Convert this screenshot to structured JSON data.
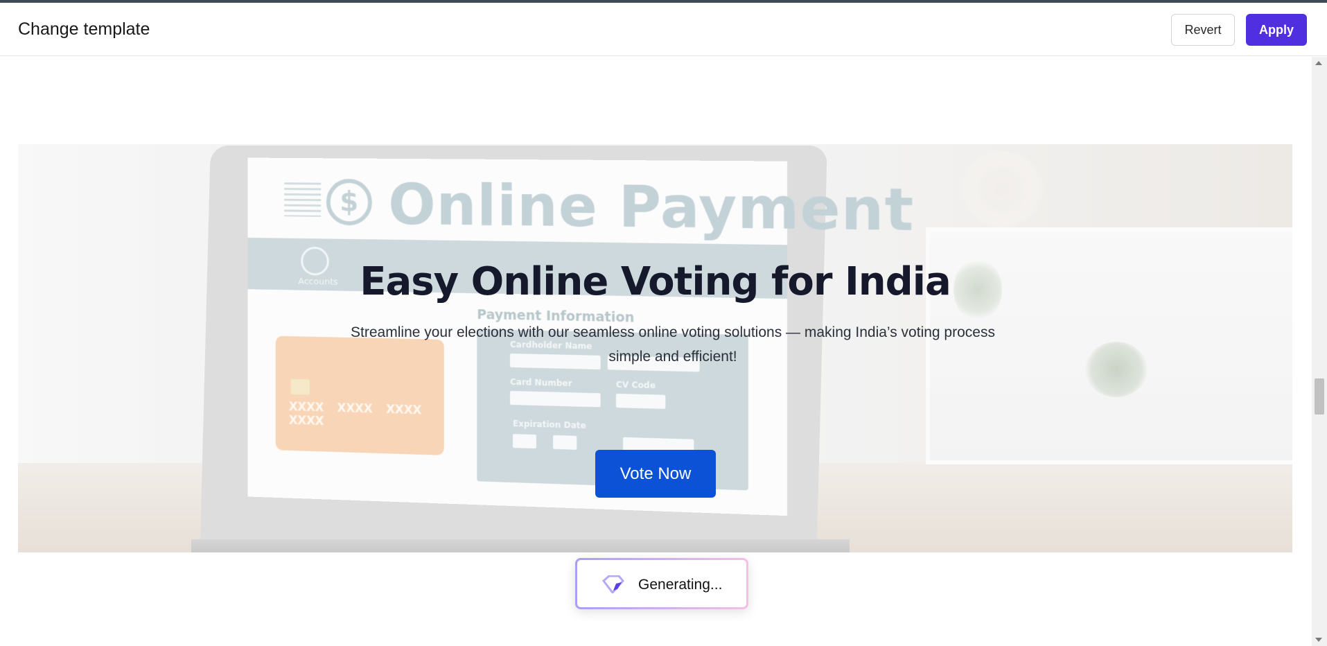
{
  "header": {
    "title": "Change template",
    "revert_label": "Revert",
    "apply_label": "Apply"
  },
  "hero": {
    "title": "Easy Online Voting for India",
    "subtitle": "Streamline your elections with our seamless online voting solutions — making India’s voting process simple and efficient!",
    "cta_label": "Vote Now",
    "background_image": {
      "title": "Online Payment",
      "band_item": "Accounts",
      "section_heading": "Payment Information",
      "card_number": "XXXX XXXX XXXX XXXX",
      "form_labels": [
        "Cardholder Name",
        "Card Number",
        "CV Code",
        "Expiration Date"
      ]
    }
  },
  "status": {
    "generating_label": "Generating..."
  },
  "colors": {
    "accent": "#4f2fe0",
    "cta": "#0b52d6",
    "title_text": "#15192b"
  }
}
